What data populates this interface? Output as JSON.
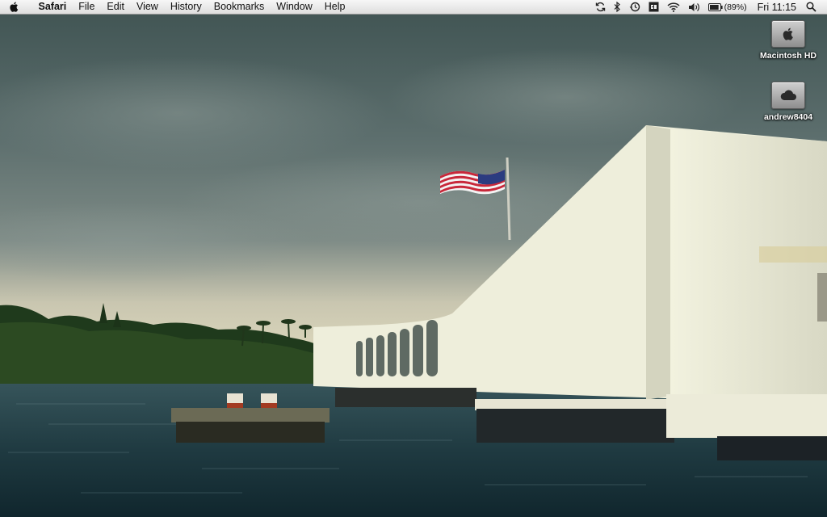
{
  "menubar": {
    "apple_icon": "apple-icon",
    "app_name": "Safari",
    "items": [
      "File",
      "Edit",
      "View",
      "History",
      "Bookmarks",
      "Window",
      "Help"
    ],
    "status": {
      "sync_icon": "sync-icon",
      "bluetooth_icon": "bluetooth-icon",
      "time_machine_icon": "time-machine-icon",
      "input_icon": "input-menu-icon",
      "wifi_icon": "wifi-icon",
      "volume_icon": "volume-icon",
      "battery_icon": "battery-icon",
      "battery_percent": "(89%)",
      "battery_level": 0.89,
      "clock": "Fri 11:15",
      "spotlight_icon": "spotlight-search-icon"
    }
  },
  "desktop": {
    "wallpaper": "USS Arizona Memorial with American flag over harbor water",
    "icons": [
      {
        "label": "Macintosh HD",
        "icon": "hard-drive-icon"
      },
      {
        "label": "andrew8404",
        "icon": "cloud-drive-icon"
      }
    ]
  }
}
